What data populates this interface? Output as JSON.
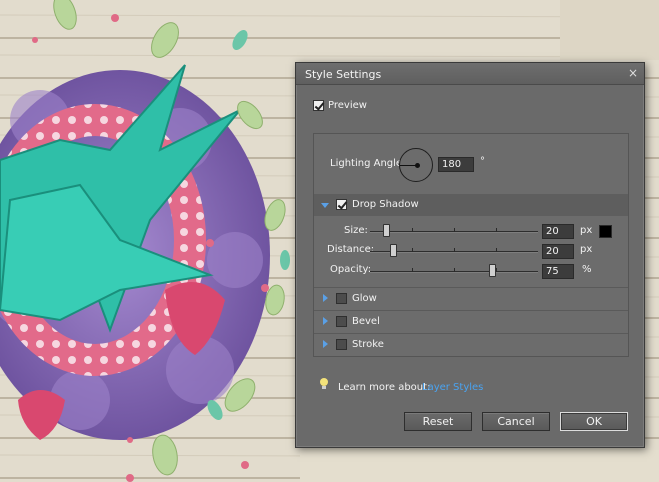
{
  "dialog": {
    "title": "Style Settings",
    "close_glyph": "×",
    "preview": {
      "label": "Preview",
      "checked": true
    },
    "lighting": {
      "label": "Lighting Angle:",
      "value": "180",
      "unit": "°"
    },
    "drop_shadow": {
      "label": "Drop Shadow",
      "checked": true,
      "expanded": true,
      "size": {
        "label": "Size:",
        "value": "20",
        "unit": "px"
      },
      "distance": {
        "label": "Distance:",
        "value": "20",
        "unit": "px"
      },
      "opacity": {
        "label": "Opacity:",
        "value": "75",
        "unit": "%"
      },
      "shadow_color": "#000000"
    },
    "sections": [
      {
        "label": "Glow",
        "checked": false
      },
      {
        "label": "Bevel",
        "checked": false
      },
      {
        "label": "Stroke",
        "checked": false
      }
    ],
    "learn_more": {
      "text": "Learn more about:",
      "link": "Layer Styles",
      "icon": "lightbulb-icon"
    },
    "buttons": {
      "reset": "Reset",
      "cancel": "Cancel",
      "ok": "OK"
    }
  },
  "colors": {
    "dialog_bg": "#6a6a6a",
    "accent_link": "#4aa3f0",
    "teal_bird": "#2fbfa8",
    "yarn_purple": "#8a6bb8"
  }
}
